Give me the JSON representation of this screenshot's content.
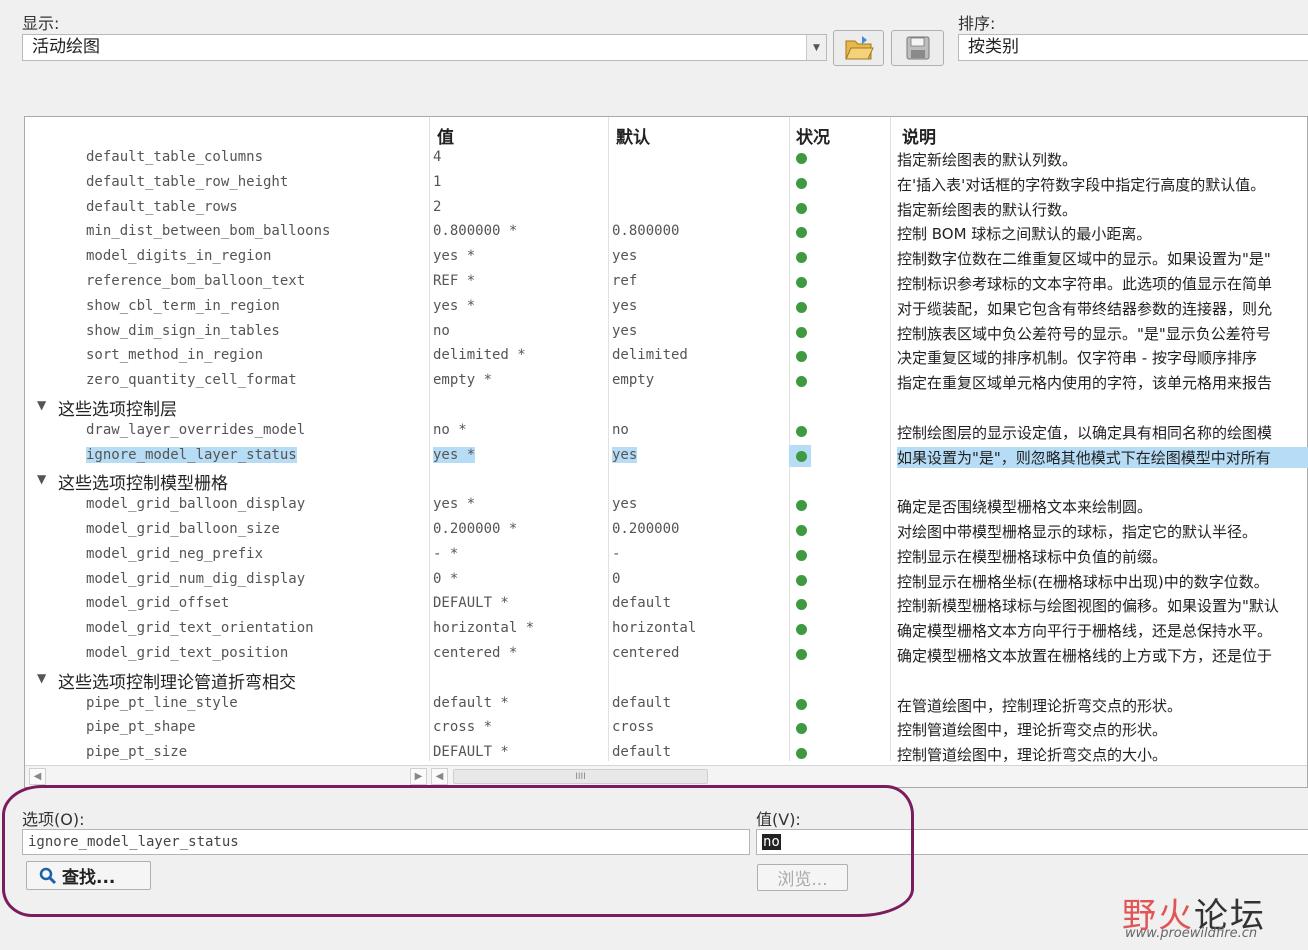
{
  "header": {
    "display_label": "显示:",
    "display_value": "活动绘图",
    "sort_label": "排序:",
    "sort_value": "按类别",
    "open_icon": "folder-open-icon",
    "save_icon": "floppy-save-icon"
  },
  "table": {
    "columns": {
      "value": "值",
      "default": "默认",
      "status": "状况",
      "description": "说明"
    },
    "rows": [
      {
        "kind": "opt",
        "name": "default_table_columns",
        "value": "4",
        "default": "",
        "desc": "指定新绘图表的默认列数。"
      },
      {
        "kind": "opt",
        "name": "default_table_row_height",
        "value": "1",
        "default": "",
        "desc": "在'插入表'对话框的字符数字段中指定行高度的默认值。"
      },
      {
        "kind": "opt",
        "name": "default_table_rows",
        "value": "2",
        "default": "",
        "desc": "指定新绘图表的默认行数。"
      },
      {
        "kind": "opt",
        "name": "min_dist_between_bom_balloons",
        "value": "0.800000 *",
        "default": "0.800000",
        "desc": "控制 BOM 球标之间默认的最小距离。"
      },
      {
        "kind": "opt",
        "name": "model_digits_in_region",
        "value": "yes *",
        "default": "yes",
        "desc": "控制数字位数在二维重复区域中的显示。如果设置为\"是\""
      },
      {
        "kind": "opt",
        "name": "reference_bom_balloon_text",
        "value": "REF *",
        "default": "ref",
        "desc": "控制标识参考球标的文本字符串。此选项的值显示在简单"
      },
      {
        "kind": "opt",
        "name": "show_cbl_term_in_region",
        "value": "yes *",
        "default": "yes",
        "desc": "对于缆装配，如果它包含有带终结器参数的连接器，则允"
      },
      {
        "kind": "opt",
        "name": "show_dim_sign_in_tables",
        "value": "no",
        "default": "yes",
        "desc": "控制族表区域中负公差符号的显示。\"是\"显示负公差符号"
      },
      {
        "kind": "opt",
        "name": "sort_method_in_region",
        "value": "delimited *",
        "default": "delimited",
        "desc": "决定重复区域的排序机制。仅字符串 - 按字母顺序排序"
      },
      {
        "kind": "opt",
        "name": "zero_quantity_cell_format",
        "value": "empty *",
        "default": "empty",
        "desc": "指定在重复区域单元格内使用的字符，该单元格用来报告"
      },
      {
        "kind": "group",
        "label": "这些选项控制层"
      },
      {
        "kind": "opt",
        "name": "draw_layer_overrides_model",
        "value": "no *",
        "default": "no",
        "desc": "控制绘图层的显示设定值，以确定具有相同名称的绘图模"
      },
      {
        "kind": "opt",
        "name": "ignore_model_layer_status",
        "value": "yes *",
        "default": "yes",
        "desc": "如果设置为\"是\"，则忽略其他模式下在绘图模型中对所有",
        "selected": true
      },
      {
        "kind": "group",
        "label": "这些选项控制模型栅格"
      },
      {
        "kind": "opt",
        "name": "model_grid_balloon_display",
        "value": "yes *",
        "default": "yes",
        "desc": "确定是否围绕模型栅格文本来绘制圆。"
      },
      {
        "kind": "opt",
        "name": "model_grid_balloon_size",
        "value": "0.200000 *",
        "default": "0.200000",
        "desc": "对绘图中带模型栅格显示的球标，指定它的默认半径。"
      },
      {
        "kind": "opt",
        "name": "model_grid_neg_prefix",
        "value": "- *",
        "default": "-",
        "desc": "控制显示在模型栅格球标中负值的前缀。"
      },
      {
        "kind": "opt",
        "name": "model_grid_num_dig_display",
        "value": "0 *",
        "default": "0",
        "desc": "控制显示在栅格坐标(在栅格球标中出现)中的数字位数。"
      },
      {
        "kind": "opt",
        "name": "model_grid_offset",
        "value": "DEFAULT *",
        "default": "default",
        "desc": "控制新模型栅格球标与绘图视图的偏移。如果设置为\"默认"
      },
      {
        "kind": "opt",
        "name": "model_grid_text_orientation",
        "value": "horizontal *",
        "default": "horizontal",
        "desc": "确定模型栅格文本方向平行于栅格线，还是总保持水平。"
      },
      {
        "kind": "opt",
        "name": "model_grid_text_position",
        "value": "centered *",
        "default": "centered",
        "desc": "确定模型栅格文本放置在栅格线的上方或下方，还是位于"
      },
      {
        "kind": "group",
        "label": "这些选项控制理论管道折弯相交"
      },
      {
        "kind": "opt",
        "name": "pipe_pt_line_style",
        "value": "default *",
        "default": "default",
        "desc": "在管道绘图中，控制理论折弯交点的形状。"
      },
      {
        "kind": "opt",
        "name": "pipe_pt_shape",
        "value": "cross *",
        "default": "cross",
        "desc": "控制管道绘图中，理论折弯交点的形状。"
      },
      {
        "kind": "opt",
        "name": "pipe_pt_size",
        "value": "DEFAULT *",
        "default": "default",
        "desc": "控制管道绘图中，理论折弯交点的大小。"
      }
    ],
    "status_color": "#3e9a41",
    "scroll_grip": "IIII"
  },
  "footer": {
    "option_label": "选项(O):",
    "option_value": "ignore_model_layer_status",
    "value_label": "值(V):",
    "value_value": "no",
    "find_button": "查找...",
    "browse_button": "浏览...",
    "search_icon": "magnifier-icon"
  },
  "watermark": {
    "name_a": "野火",
    "name_b": "论坛",
    "url": "www.proewildfire.cn"
  },
  "colors": {
    "selection": "#b7dcf5",
    "annotation": "#7b1c5e"
  }
}
